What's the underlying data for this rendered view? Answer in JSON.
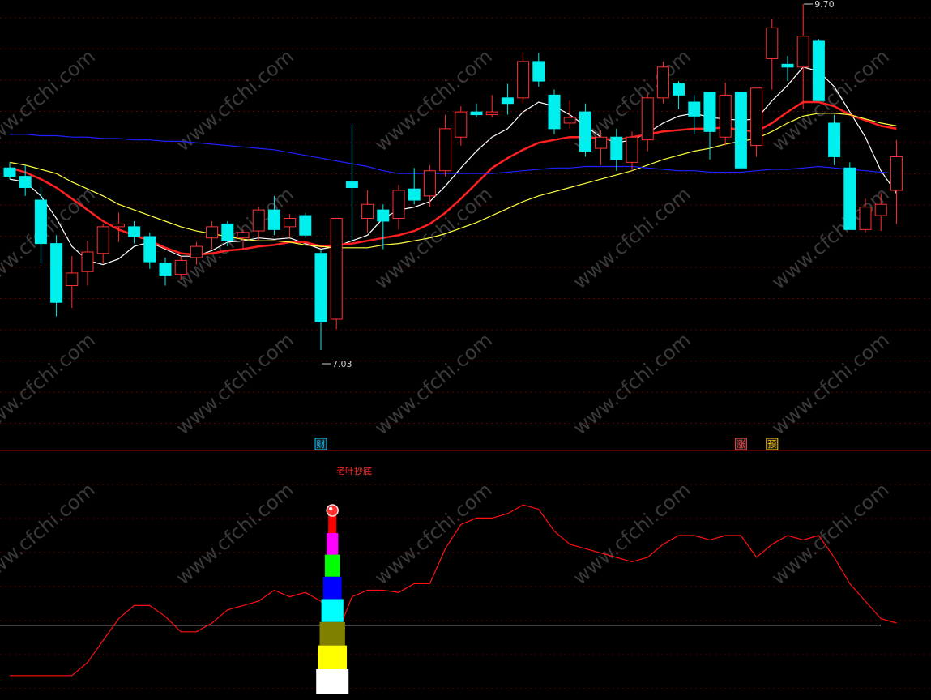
{
  "chart_data": [
    {
      "type": "candlestick",
      "title": "",
      "ylim": [
        6.8,
        9.75
      ],
      "annotations": {
        "high_label": "9.70",
        "low_label": "7.03"
      },
      "markers": [
        {
          "label": "财",
          "index": 20,
          "color": "#00c8ff"
        },
        {
          "label": "涨",
          "index": 47,
          "color": "#ff4040"
        },
        {
          "label": "预",
          "index": 49,
          "color": "#ffcc00"
        }
      ],
      "candles": [
        {
          "o": 8.58,
          "h": 8.62,
          "l": 8.5,
          "c": 8.52
        },
        {
          "o": 8.52,
          "h": 8.6,
          "l": 8.38,
          "c": 8.44
        },
        {
          "o": 8.35,
          "h": 8.44,
          "l": 7.9,
          "c": 8.04
        },
        {
          "o": 8.04,
          "h": 8.1,
          "l": 7.52,
          "c": 7.62
        },
        {
          "o": 7.74,
          "h": 7.95,
          "l": 7.58,
          "c": 7.83
        },
        {
          "o": 7.84,
          "h": 8.06,
          "l": 7.74,
          "c": 7.98
        },
        {
          "o": 7.97,
          "h": 8.18,
          "l": 7.9,
          "c": 8.16
        },
        {
          "o": 8.16,
          "h": 8.26,
          "l": 8.05,
          "c": 8.18
        },
        {
          "o": 8.16,
          "h": 8.2,
          "l": 8.04,
          "c": 8.09
        },
        {
          "o": 8.09,
          "h": 8.12,
          "l": 7.86,
          "c": 7.91
        },
        {
          "o": 7.9,
          "h": 7.94,
          "l": 7.74,
          "c": 7.81
        },
        {
          "o": 7.82,
          "h": 7.95,
          "l": 7.78,
          "c": 7.92
        },
        {
          "o": 7.94,
          "h": 8.05,
          "l": 7.89,
          "c": 8.02
        },
        {
          "o": 8.08,
          "h": 8.2,
          "l": 8.0,
          "c": 8.16
        },
        {
          "o": 8.18,
          "h": 8.2,
          "l": 8.02,
          "c": 8.06
        },
        {
          "o": 8.08,
          "h": 8.14,
          "l": 8.0,
          "c": 8.12
        },
        {
          "o": 8.13,
          "h": 8.3,
          "l": 8.06,
          "c": 8.28
        },
        {
          "o": 8.28,
          "h": 8.38,
          "l": 8.1,
          "c": 8.14
        },
        {
          "o": 8.16,
          "h": 8.25,
          "l": 8.08,
          "c": 8.22
        },
        {
          "o": 8.24,
          "h": 8.26,
          "l": 8.08,
          "c": 8.1
        },
        {
          "o": 7.97,
          "h": 8.0,
          "l": 7.28,
          "c": 7.48
        },
        {
          "o": 7.5,
          "h": 8.22,
          "l": 7.43,
          "c": 8.22
        },
        {
          "o": 8.48,
          "h": 8.89,
          "l": 8.06,
          "c": 8.44
        },
        {
          "o": 8.22,
          "h": 8.42,
          "l": 8.12,
          "c": 8.32
        },
        {
          "o": 8.28,
          "h": 8.32,
          "l": 8.0,
          "c": 8.2
        },
        {
          "o": 8.22,
          "h": 8.46,
          "l": 8.14,
          "c": 8.42
        },
        {
          "o": 8.43,
          "h": 8.58,
          "l": 8.32,
          "c": 8.35
        },
        {
          "o": 8.38,
          "h": 8.6,
          "l": 8.3,
          "c": 8.56
        },
        {
          "o": 8.56,
          "h": 8.96,
          "l": 8.52,
          "c": 8.86
        },
        {
          "o": 8.8,
          "h": 9.02,
          "l": 8.74,
          "c": 8.98
        },
        {
          "o": 8.98,
          "h": 9.04,
          "l": 8.94,
          "c": 8.96
        },
        {
          "o": 8.96,
          "h": 9.1,
          "l": 8.94,
          "c": 8.98
        },
        {
          "o": 9.08,
          "h": 9.18,
          "l": 8.96,
          "c": 9.04
        },
        {
          "o": 9.08,
          "h": 9.4,
          "l": 9.04,
          "c": 9.34
        },
        {
          "o": 9.34,
          "h": 9.4,
          "l": 9.16,
          "c": 9.2
        },
        {
          "o": 9.1,
          "h": 9.14,
          "l": 8.82,
          "c": 8.86
        },
        {
          "o": 8.9,
          "h": 9.06,
          "l": 8.86,
          "c": 8.94
        },
        {
          "o": 8.98,
          "h": 9.04,
          "l": 8.66,
          "c": 8.7
        },
        {
          "o": 8.72,
          "h": 8.85,
          "l": 8.6,
          "c": 8.8
        },
        {
          "o": 8.8,
          "h": 8.86,
          "l": 8.56,
          "c": 8.64
        },
        {
          "o": 8.62,
          "h": 8.84,
          "l": 8.56,
          "c": 8.8
        },
        {
          "o": 8.78,
          "h": 9.11,
          "l": 8.7,
          "c": 9.08
        },
        {
          "o": 9.08,
          "h": 9.34,
          "l": 9.04,
          "c": 9.3
        },
        {
          "o": 9.18,
          "h": 9.2,
          "l": 9.0,
          "c": 9.1
        },
        {
          "o": 9.05,
          "h": 9.1,
          "l": 8.82,
          "c": 8.95
        },
        {
          "o": 9.12,
          "h": 9.12,
          "l": 8.64,
          "c": 8.84
        },
        {
          "o": 8.8,
          "h": 9.19,
          "l": 8.74,
          "c": 9.1
        },
        {
          "o": 9.12,
          "h": 9.12,
          "l": 8.58,
          "c": 8.58
        },
        {
          "o": 8.74,
          "h": 9.15,
          "l": 8.66,
          "c": 9.15
        },
        {
          "o": 9.36,
          "h": 9.64,
          "l": 9.14,
          "c": 9.58
        },
        {
          "o": 9.32,
          "h": 9.38,
          "l": 9.2,
          "c": 9.3
        },
        {
          "o": 9.3,
          "h": 9.75,
          "l": 9.0,
          "c": 9.52
        },
        {
          "o": 9.49,
          "h": 9.5,
          "l": 9.06,
          "c": 9.06
        },
        {
          "o": 8.9,
          "h": 8.96,
          "l": 8.6,
          "c": 8.66
        },
        {
          "o": 8.58,
          "h": 8.62,
          "l": 8.14,
          "c": 8.14
        },
        {
          "o": 8.14,
          "h": 8.36,
          "l": 8.12,
          "c": 8.3
        },
        {
          "o": 8.24,
          "h": 8.4,
          "l": 8.13,
          "c": 8.32
        },
        {
          "o": 8.42,
          "h": 8.78,
          "l": 8.18,
          "c": 8.66
        }
      ],
      "series": [
        {
          "color": "#ffffff",
          "values": [
            8.5,
            8.48,
            8.38,
            8.22,
            8.02,
            7.92,
            7.89,
            7.93,
            8.02,
            8.05,
            8.0,
            7.95,
            7.95,
            7.99,
            8.05,
            8.06,
            8.08,
            8.07,
            8.08,
            8.04,
            8.0,
            8.02,
            8.06,
            8.1,
            8.22,
            8.28,
            8.3,
            8.34,
            8.45,
            8.58,
            8.7,
            8.8,
            8.86,
            8.98,
            9.05,
            9.02,
            8.96,
            8.88,
            8.8,
            8.76,
            8.78,
            8.83,
            8.9,
            8.95,
            8.97,
            8.94,
            8.93,
            8.92,
            8.93,
            9.06,
            9.17,
            9.3,
            9.27,
            9.16,
            8.98,
            8.8,
            8.56,
            8.4
          ]
        },
        {
          "color": "#ff2020",
          "values": [
            8.58,
            8.55,
            8.5,
            8.44,
            8.36,
            8.28,
            8.2,
            8.14,
            8.1,
            8.06,
            8.01,
            7.97,
            7.96,
            7.97,
            7.99,
            8.0,
            8.02,
            8.03,
            8.05,
            8.05,
            8.02,
            8.03,
            8.04,
            8.06,
            8.08,
            8.1,
            8.13,
            8.18,
            8.26,
            8.36,
            8.47,
            8.58,
            8.65,
            8.71,
            8.76,
            8.78,
            8.8,
            8.8,
            8.79,
            8.78,
            8.8,
            8.82,
            8.84,
            8.85,
            8.86,
            8.86,
            8.87,
            8.85,
            8.84,
            8.9,
            8.98,
            9.05,
            9.05,
            9.02,
            8.96,
            8.92,
            8.88,
            8.86
          ]
        },
        {
          "color": "#ffff40",
          "values": [
            8.62,
            8.6,
            8.57,
            8.54,
            8.48,
            8.43,
            8.38,
            8.32,
            8.28,
            8.24,
            8.2,
            8.16,
            8.13,
            8.11,
            8.09,
            8.07,
            8.06,
            8.06,
            8.05,
            8.03,
            8.02,
            8.01,
            8.01,
            8.01,
            8.03,
            8.04,
            8.06,
            8.08,
            8.11,
            8.15,
            8.19,
            8.24,
            8.29,
            8.34,
            8.38,
            8.41,
            8.44,
            8.47,
            8.5,
            8.53,
            8.56,
            8.6,
            8.64,
            8.67,
            8.7,
            8.72,
            8.75,
            8.77,
            8.79,
            8.84,
            8.9,
            8.95,
            8.97,
            8.97,
            8.96,
            8.93,
            8.9,
            8.88
          ]
        },
        {
          "color": "#2020ff",
          "values": [
            8.82,
            8.82,
            8.81,
            8.81,
            8.8,
            8.8,
            8.79,
            8.79,
            8.78,
            8.78,
            8.77,
            8.77,
            8.76,
            8.75,
            8.74,
            8.73,
            8.72,
            8.71,
            8.69,
            8.67,
            8.65,
            8.63,
            8.61,
            8.59,
            8.56,
            8.54,
            8.54,
            8.54,
            8.54,
            8.54,
            8.54,
            8.54,
            8.55,
            8.56,
            8.57,
            8.58,
            8.58,
            8.59,
            8.59,
            8.59,
            8.59,
            8.58,
            8.57,
            8.56,
            8.56,
            8.55,
            8.55,
            8.55,
            8.56,
            8.57,
            8.57,
            8.58,
            8.59,
            8.58,
            8.57,
            8.56,
            8.55,
            8.54
          ]
        }
      ]
    },
    {
      "type": "line",
      "title": "",
      "indicator_label": "老叶抄底",
      "ylim": [
        0,
        100
      ],
      "reference_line": 29,
      "series": [
        {
          "color": "#ff1010",
          "values": [
            6,
            6,
            6,
            6,
            6,
            12,
            22,
            32,
            38,
            38,
            33,
            26,
            26,
            30,
            36,
            38,
            40,
            45,
            42,
            44,
            40,
            24,
            42,
            45,
            45,
            44,
            48,
            48,
            64,
            75,
            78,
            78,
            80,
            84,
            82,
            72,
            66,
            64,
            62,
            60,
            58,
            60,
            66,
            70,
            70,
            68,
            70,
            70,
            60,
            66,
            70,
            68,
            70,
            60,
            48,
            40,
            32,
            30
          ]
        }
      ],
      "stack_blocks": [
        "#ffffff",
        "#ffff00",
        "#808000",
        "#00ffff",
        "#0000ff",
        "#00ff00",
        "#ff00ff",
        "#ff0000"
      ]
    }
  ]
}
